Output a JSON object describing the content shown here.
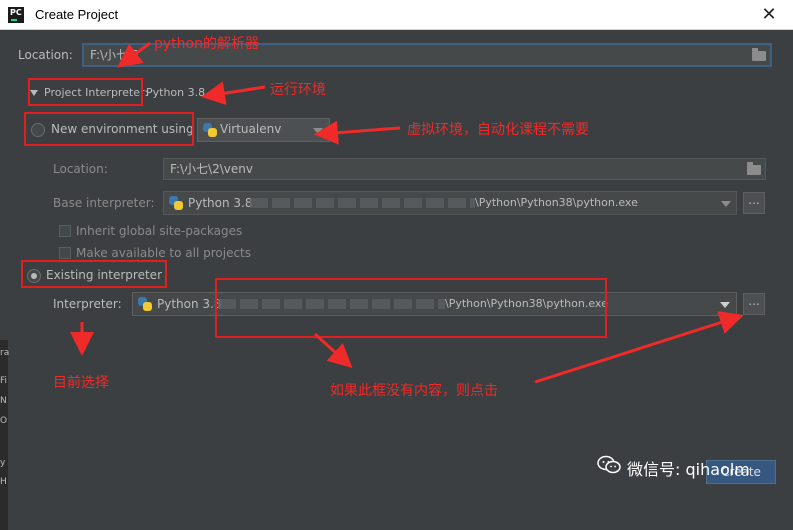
{
  "window": {
    "title": "Create Project",
    "app_icon": "PC"
  },
  "location": {
    "label": "Location:",
    "value": "F:\\小七\\2"
  },
  "interpreter_section": {
    "title": "Project Interpreter:",
    "version": "Python 3.8"
  },
  "new_env": {
    "label": "New environment using",
    "tool": "Virtualenv",
    "location_label": "Location:",
    "location_value": "F:\\小七\\2\\venv",
    "base_label": "Base interpreter:",
    "base_value": "Python 3.8",
    "base_path_suffix": "\\Python\\Python38\\python.exe",
    "inherit_label": "Inherit global site-packages",
    "available_label": "Make available to all projects"
  },
  "existing": {
    "label": "Existing interpreter",
    "interpreter_label": "Interpreter:",
    "interpreter_value": "Python 3.8",
    "interpreter_path_suffix": "\\Python\\Python38\\python.exe"
  },
  "annotations": {
    "parser": "python的解析器",
    "runtime": "运行环境",
    "venv_note": "虚拟环境，自动化课程不需要",
    "current_choice": "目前选择",
    "if_empty": "如果此框没有内容，则点击"
  },
  "watermark": {
    "text": "微信号: qihaolm"
  },
  "buttons": {
    "create": "Create",
    "dots": "..."
  },
  "left_strip_letters": [
    "ra",
    "Fi",
    "N",
    "O",
    "y",
    "H"
  ],
  "colors": {
    "background": "#3c3f41",
    "annotation": "#f02a28",
    "accent": "#3d6185"
  }
}
